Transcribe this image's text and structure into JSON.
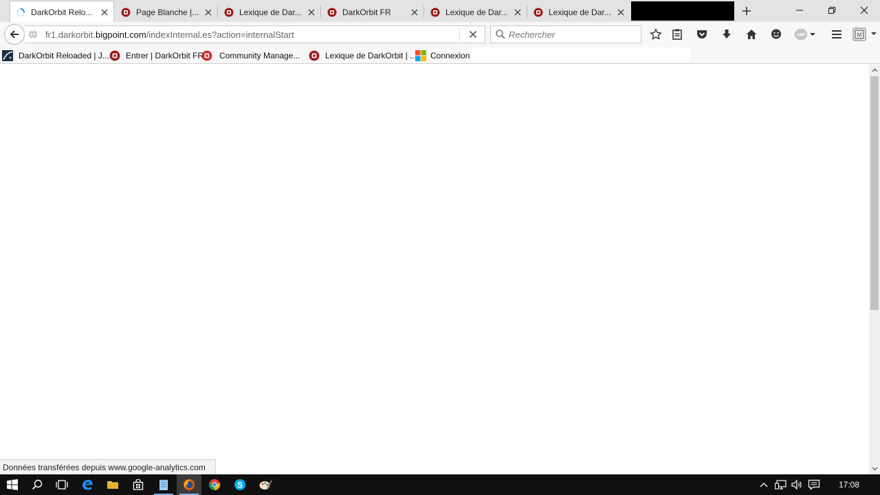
{
  "tabs": [
    {
      "title": "DarkOrbit Relo...",
      "icon": "loading-spinner-icon"
    },
    {
      "title": "Page Blanche |...",
      "icon": "bigpoint-favicon"
    },
    {
      "title": "Lexique de Dar...",
      "icon": "bigpoint-favicon"
    },
    {
      "title": "DarkOrbit FR",
      "icon": "bigpoint-favicon"
    },
    {
      "title": "Lexique de Dar...",
      "icon": "bigpoint-favicon"
    },
    {
      "title": "Lexique de Dar...",
      "icon": "bigpoint-favicon"
    }
  ],
  "url": {
    "prefix": "fr1.darkorbit.",
    "domain": "bigpoint.com",
    "path": "/indexInternal.es?action=internalStart"
  },
  "search": {
    "placeholder": "Rechercher"
  },
  "bookmarks": [
    {
      "label": "DarkOrbit Reloaded | J...",
      "icon": "darkorbit-favicon"
    },
    {
      "label": "Entrer | DarkOrbit FR",
      "icon": "bigpoint-favicon"
    },
    {
      "label": "Community Manage...",
      "icon": "bigpoint-red-favicon"
    },
    {
      "label": "Lexique de DarkOrbit | ...",
      "icon": "bigpoint-favicon"
    },
    {
      "label": "Connexion",
      "icon": "microsoft-favicon"
    }
  ],
  "status": {
    "text": "Données transférées depuis www.google-analytics.com"
  },
  "taskbar": {
    "time": "17:08"
  },
  "colors": {
    "bigpoint_red": "#9b1b1b",
    "taskbar": "#101010",
    "firefox_orange": "#e66000"
  }
}
